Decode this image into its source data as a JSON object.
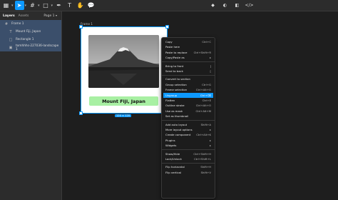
{
  "toolbar": {
    "tools": [
      {
        "name": "main-menu",
        "glyph": "▦"
      },
      {
        "name": "move",
        "glyph": "➤"
      },
      {
        "name": "frame",
        "glyph": "#"
      },
      {
        "name": "shape",
        "glyph": "□"
      },
      {
        "name": "pen",
        "glyph": "✒"
      },
      {
        "name": "text",
        "glyph": "T"
      },
      {
        "name": "hand",
        "glyph": "✋"
      },
      {
        "name": "comment",
        "glyph": "💬"
      }
    ],
    "right_tools": [
      {
        "name": "component",
        "glyph": "◆"
      },
      {
        "name": "mask",
        "glyph": "◐"
      },
      {
        "name": "boolean",
        "glyph": "◧"
      },
      {
        "name": "code",
        "glyph": "</>"
      }
    ]
  },
  "sidebar": {
    "tab_layers": "Layers",
    "tab_assets": "Assets",
    "page_selector": "Page 1",
    "layers": [
      {
        "label": "Frame 1",
        "icon": "#",
        "depth": 0,
        "selected": true
      },
      {
        "label": "Mount Fiji, Japan",
        "icon": "T",
        "depth": 1,
        "selected": true
      },
      {
        "label": "Rectangle 1",
        "icon": "□",
        "depth": 1,
        "selected": true
      },
      {
        "label": "tomhhhs-227036-landscape 1",
        "icon": "▣",
        "depth": 1,
        "selected": true
      }
    ]
  },
  "canvas": {
    "frame_label": "Frame 1",
    "caption": "Mount Fiji, Japan",
    "size_badge": "120 × 120"
  },
  "context_menu": {
    "items": [
      {
        "label": "Copy",
        "shortcut": "Ctrl+C"
      },
      {
        "label": "Paste here",
        "shortcut": ""
      },
      {
        "label": "Paste to replace",
        "shortcut": "Ctrl+Shift+R"
      },
      {
        "label": "Copy/Paste as",
        "shortcut": "▸"
      },
      {
        "sep": true
      },
      {
        "label": "Bring to front",
        "shortcut": "]"
      },
      {
        "label": "Send to back",
        "shortcut": "["
      },
      {
        "sep": true
      },
      {
        "label": "Convert to section",
        "shortcut": ""
      },
      {
        "label": "Group selection",
        "shortcut": "Ctrl+G"
      },
      {
        "label": "Frame selection",
        "shortcut": "Ctrl+Alt+G"
      },
      {
        "label": "Ungroup",
        "shortcut": "Ctrl+⌫",
        "highlighted": true
      },
      {
        "label": "Flatten",
        "shortcut": "Ctrl+E"
      },
      {
        "label": "Outline stroke",
        "shortcut": "Ctrl+Alt+O"
      },
      {
        "label": "Use as mask",
        "shortcut": "Ctrl+Alt+M"
      },
      {
        "label": "Set as thumbnail",
        "shortcut": ""
      },
      {
        "sep": true
      },
      {
        "label": "Add auto layout",
        "shortcut": "Shift+A"
      },
      {
        "label": "More layout options",
        "shortcut": "▸"
      },
      {
        "label": "Create component",
        "shortcut": "Ctrl+Alt+K"
      },
      {
        "label": "Plugins",
        "shortcut": "▸"
      },
      {
        "label": "Widgets",
        "shortcut": "▸"
      },
      {
        "sep": true
      },
      {
        "label": "Show/Hide",
        "shortcut": "Ctrl+Shift+H"
      },
      {
        "label": "Lock/Unlock",
        "shortcut": "Ctrl+Shift+L"
      },
      {
        "sep": true
      },
      {
        "label": "Flip horizontal",
        "shortcut": "Shift+H"
      },
      {
        "label": "Flip vertical",
        "shortcut": "Shift+V"
      }
    ]
  }
}
